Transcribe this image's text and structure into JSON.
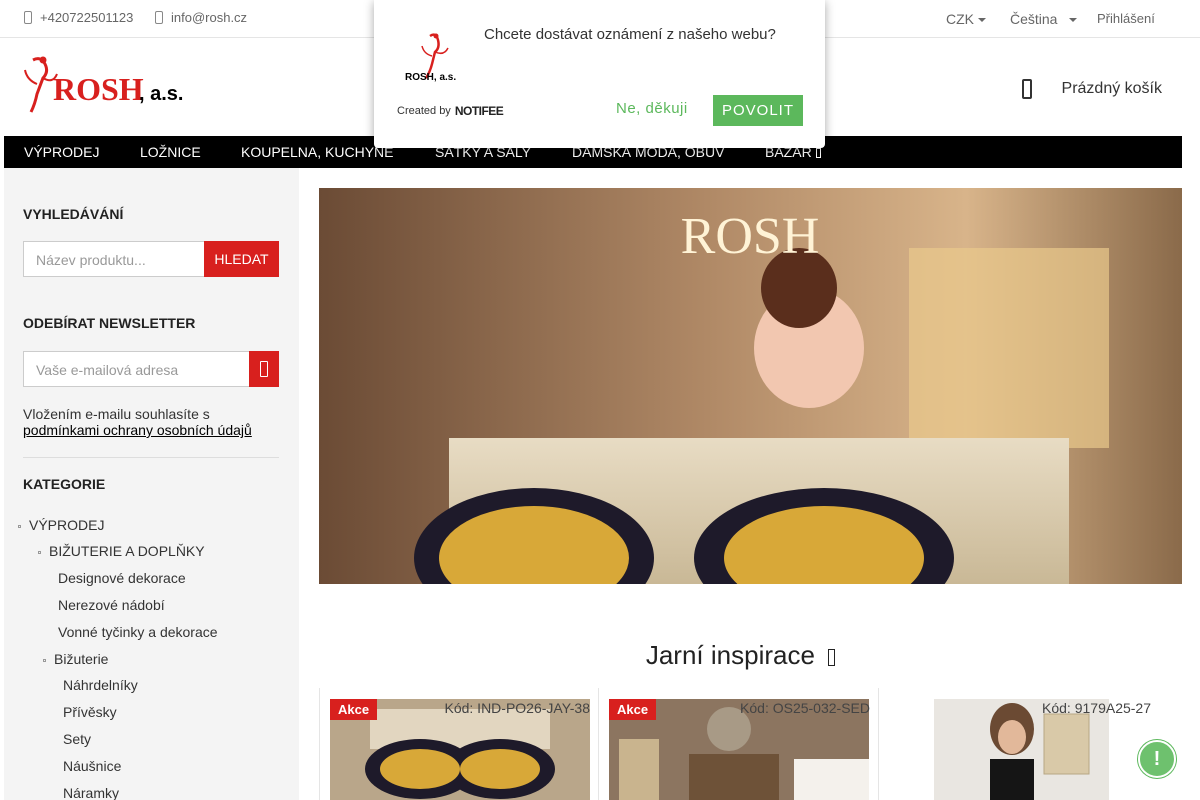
{
  "topbar": {
    "phone": "+420722501123",
    "email": "info@rosh.cz",
    "currency": "CZK",
    "language": "Čeština",
    "login": "Přihlášení"
  },
  "header": {
    "logo_text": "ROSH, a.s.",
    "cart_label": "Prázdný košík"
  },
  "nav": {
    "items": [
      "VÝPRODEJ",
      "LOŽNICE",
      "KOUPELNA, KUCHYNĚ",
      "ŠÁTKY A ŠÁLY",
      "DÁMSKÁ MÓDA, OBUV",
      "BAZAR"
    ]
  },
  "sidebar": {
    "search_heading": "VYHLEDÁVÁNÍ",
    "search_placeholder": "Název produktu...",
    "search_button": "HLEDAT",
    "newsletter_heading": "ODEBÍRAT NEWSLETTER",
    "newsletter_placeholder": "Vaše e-mailová adresa",
    "consent_text": "Vložením e-mailu souhlasíte s",
    "consent_link": "podmínkami ochrany osobních údajů",
    "categories_heading": "KATEGORIE",
    "categories": [
      "VÝPRODEJ",
      "BIŽUTERIE A DOPLŇKY",
      "Designové dekorace",
      "Nerezové nádobí",
      "Vonné tyčinky a dekorace",
      "Bižuterie",
      "Náhrdelníky",
      "Přívěsky",
      "Sety",
      "Náušnice",
      "Náramky"
    ]
  },
  "banner": {
    "title": "ROSH"
  },
  "section": {
    "title": "Jarní inspirace"
  },
  "products": [
    {
      "badge": "Akce",
      "code": "Kód: IND-PO26-JAY-38"
    },
    {
      "badge": "Akce",
      "code": "Kód: OS25-032-SED"
    },
    {
      "badge": "",
      "code": "Kód: 9179A25-27"
    }
  ],
  "popup": {
    "message": "Chcete dostávat oznámení z našeho webu?",
    "created_by": "Created by",
    "brand": "NOTIFEE",
    "no_label": "Ne, děkuji",
    "yes_label": "POVOLIT",
    "logo_text": "ROSH, a.s."
  },
  "colors": {
    "accent": "#d8201e",
    "nav_bg": "#000000",
    "popup_green": "#5cb85c"
  }
}
